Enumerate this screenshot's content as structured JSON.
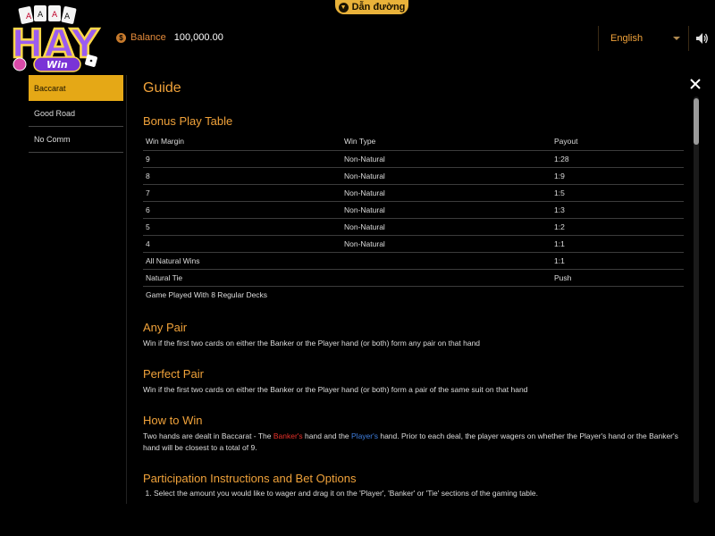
{
  "guide_tab": {
    "label": "Dẫn đường"
  },
  "logo": {
    "main": "HAY",
    "sub": "Win"
  },
  "balance": {
    "label": "Balance",
    "value": "100,000.00"
  },
  "language": {
    "selected": "English"
  },
  "sidebar": {
    "items": [
      {
        "label": "Baccarat",
        "active": true
      },
      {
        "label": "Good Road",
        "active": false
      },
      {
        "label": "No Comm",
        "active": false
      }
    ]
  },
  "guide": {
    "title": "Guide",
    "bonus": {
      "heading": "Bonus Play Table",
      "columns": [
        "Win Margin",
        "Win Type",
        "Payout"
      ],
      "rows": [
        [
          "9",
          "Non-Natural",
          "1:28"
        ],
        [
          "8",
          "Non-Natural",
          "1:9"
        ],
        [
          "7",
          "Non-Natural",
          "1:5"
        ],
        [
          "6",
          "Non-Natural",
          "1:3"
        ],
        [
          "5",
          "Non-Natural",
          "1:2"
        ],
        [
          "4",
          "Non-Natural",
          "1:1"
        ],
        [
          "All Natural Wins",
          "",
          "1:1"
        ],
        [
          "Natural Tie",
          "",
          "Push"
        ]
      ],
      "note": "Game Played With 8 Regular Decks"
    },
    "any_pair": {
      "heading": "Any Pair",
      "text": "Win if the first two cards on either the Banker or the Player hand (or both) form any pair on that hand"
    },
    "perfect_pair": {
      "heading": "Perfect Pair",
      "text": "Win if the first two cards on either the Banker or the Player hand (or both) form a pair of the same suit on that hand"
    },
    "how_to_win": {
      "heading": "How to Win",
      "part1": "Two hands are dealt in Baccarat - The ",
      "banker": "Banker's",
      "part2": " hand and the ",
      "player": "Player's",
      "part3": " hand. Prior to each deal, the player wagers on whether the Player's hand or the Banker's hand will be closest to a total of 9."
    },
    "participation": {
      "heading": "Participation Instructions and Bet Options",
      "items": [
        "Select the amount you would like to wager and drag it on the 'Player', 'Banker' or 'Tie' sections of the gaming table."
      ]
    }
  },
  "colors": {
    "accent": "#f0a23a",
    "active_tab": "#e5a816",
    "banker": "#e8312a",
    "player": "#3f7fe0"
  }
}
